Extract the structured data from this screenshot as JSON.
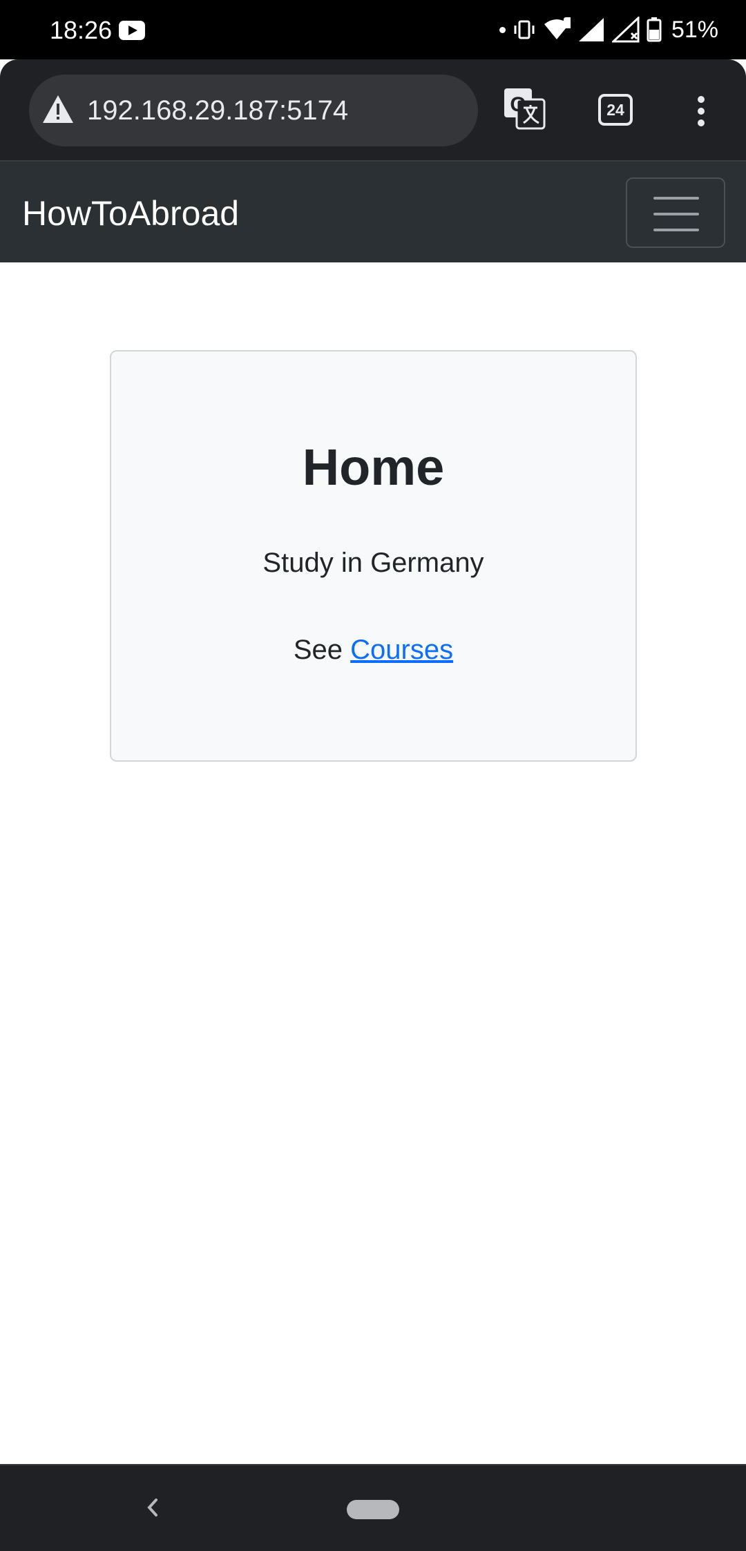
{
  "status_bar": {
    "time": "18:26",
    "battery": "51%",
    "icons": [
      "youtube-icon",
      "vibrate-icon",
      "wifi-icon",
      "signal-icon",
      "battery-icon"
    ]
  },
  "browser": {
    "url": "192.168.29.187:5174",
    "tab_count": "24",
    "icons": [
      "warning-icon",
      "translate-icon",
      "tabs-icon",
      "more-vert-icon"
    ]
  },
  "navbar": {
    "brand": "HowToAbroad",
    "toggler_icon": "hamburger-icon"
  },
  "main": {
    "title": "Home",
    "subtitle": "Study in Germany",
    "link_prefix": "See",
    "link_label": "Courses"
  },
  "system_nav": {
    "icons": [
      "back-icon",
      "home-pill"
    ]
  },
  "colors": {
    "status_bar_bg": "#000000",
    "toolbar_bg": "#202124",
    "navbar_bg": "#2b3035",
    "card_bg": "#f8f9fa",
    "link": "#0d6efd",
    "text": "#212529"
  }
}
